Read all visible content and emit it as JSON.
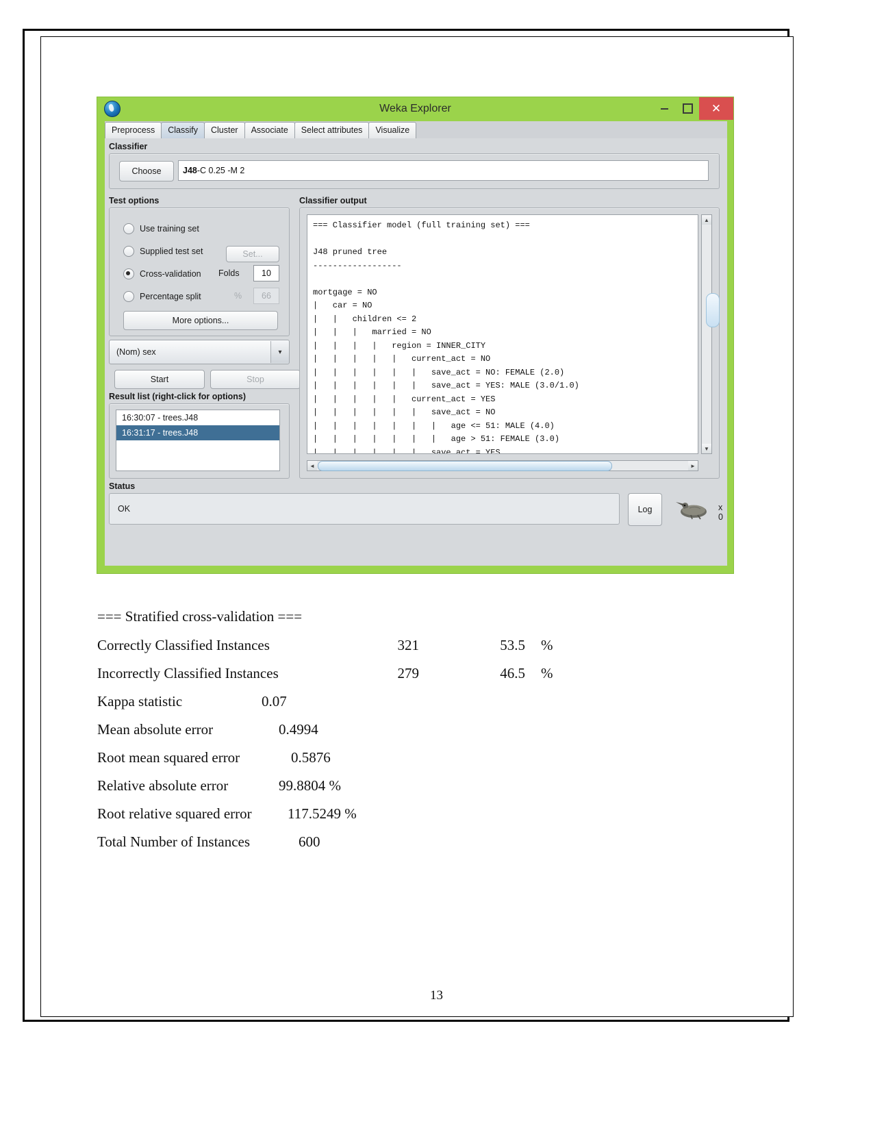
{
  "window": {
    "title": "Weka Explorer",
    "icon": "weka-bird-icon",
    "minimize_label": "–",
    "maximize_label": "□",
    "close_label": "✕",
    "titlebar_color": "#9bd34b",
    "close_color": "#d94f4f"
  },
  "tabs": [
    {
      "label": "Preprocess",
      "active": false
    },
    {
      "label": "Classify",
      "active": true
    },
    {
      "label": "Cluster",
      "active": false
    },
    {
      "label": "Associate",
      "active": false
    },
    {
      "label": "Select attributes",
      "active": false
    },
    {
      "label": "Visualize",
      "active": false
    }
  ],
  "classifier": {
    "group_label": "Classifier",
    "choose_label": "Choose",
    "name": "J48",
    "options": " -C 0.25 -M 2"
  },
  "test_options": {
    "group_label": "Test options",
    "items": [
      {
        "label": "Use training set",
        "selected": false
      },
      {
        "label": "Supplied test set",
        "selected": false
      },
      {
        "label": "Cross-validation",
        "selected": true
      },
      {
        "label": "Percentage split",
        "selected": false
      }
    ],
    "set_label": "Set...",
    "folds_label": "Folds",
    "folds_value": "10",
    "percent_sign": "%",
    "percent_value": "66",
    "more_options_label": "More options..."
  },
  "class_combo": {
    "value": "(Nom) sex",
    "arrow": "▾"
  },
  "actions": {
    "start_label": "Start",
    "stop_label": "Stop"
  },
  "result_list": {
    "label": "Result list (right-click for options)",
    "items": [
      {
        "label": "16:30:07 - trees.J48",
        "selected": false
      },
      {
        "label": "16:31:17 - trees.J48",
        "selected": true
      }
    ]
  },
  "classifier_output": {
    "label": "Classifier output",
    "text": "=== Classifier model (full training set) ===\n\nJ48 pruned tree\n------------------\n\nmortgage = NO\n|   car = NO\n|   |   children <= 2\n|   |   |   married = NO\n|   |   |   |   region = INNER_CITY\n|   |   |   |   |   current_act = NO\n|   |   |   |   |   |   save_act = NO: FEMALE (2.0)\n|   |   |   |   |   |   save_act = YES: MALE (3.0/1.0)\n|   |   |   |   |   current_act = YES\n|   |   |   |   |   |   save_act = NO\n|   |   |   |   |   |   |   age <= 51: MALE (4.0)\n|   |   |   |   |   |   |   age > 51: FEMALE (3.0)\n|   |   |   |   |   |   save_act = YES\n|   |   |   |   |   |   |   pep = YES",
    "scroll_up": "▲",
    "scroll_down": "▼",
    "scroll_left": "◄",
    "scroll_right": "►"
  },
  "status": {
    "label": "Status",
    "message": "OK",
    "log_label": "Log",
    "busy_count": "x 0"
  },
  "report": {
    "heading": "=== Stratified cross-validation ===",
    "rows": [
      {
        "label": "Correctly Classified Instances",
        "v1": "321",
        "v2": "53.5",
        "v3": "%"
      },
      {
        "label": "Incorrectly Classified Instances",
        "v1": "279",
        "v2": "46.5",
        "v3": "%"
      },
      {
        "label": "Kappa statistic",
        "v1": "0.07",
        "v2": "",
        "v3": ""
      },
      {
        "label": "Mean absolute error",
        "v1": "0.4994",
        "v2": "",
        "v3": ""
      },
      {
        "label": "Root mean squared error",
        "v1": "0.5876",
        "v2": "",
        "v3": ""
      },
      {
        "label": "Relative absolute error",
        "v1": "99.8804 %",
        "v2": "",
        "v3": ""
      },
      {
        "label": "Root relative squared error",
        "v1": "117.5249 %",
        "v2": "",
        "v3": ""
      },
      {
        "label": "Total Number of Instances",
        "v1": "600",
        "v2": "",
        "v3": ""
      }
    ]
  },
  "page": {
    "number": "13"
  }
}
